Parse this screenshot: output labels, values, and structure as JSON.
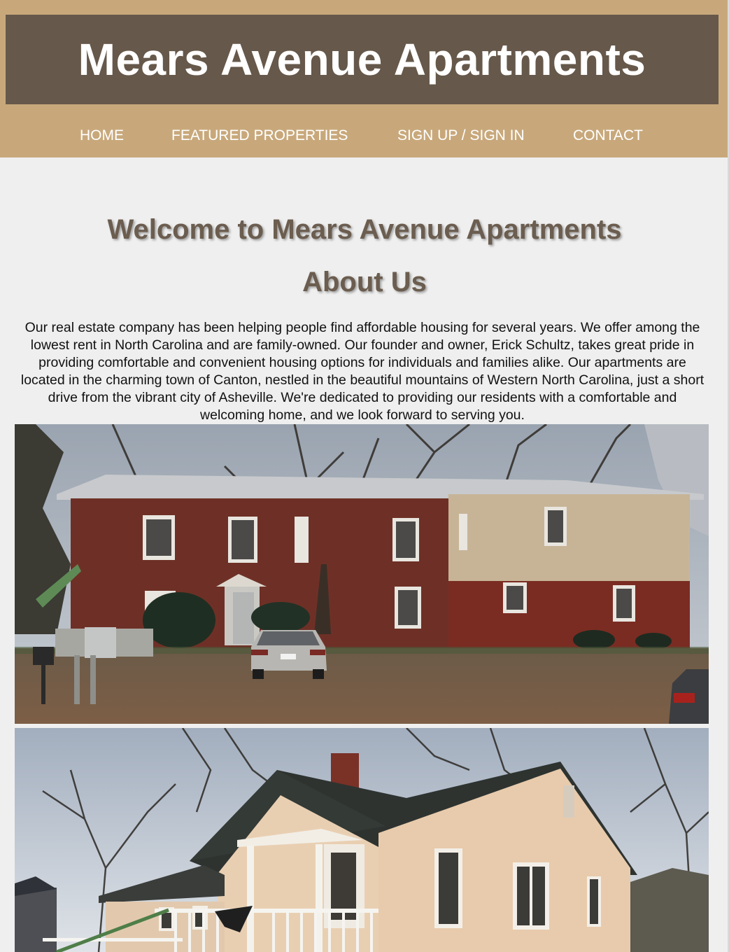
{
  "header": {
    "title": "Mears Avenue Apartments"
  },
  "nav": {
    "items": [
      {
        "label": "HOME"
      },
      {
        "label": "FEATURED PROPERTIES"
      },
      {
        "label": "SIGN UP / SIGN IN"
      },
      {
        "label": "CONTACT"
      }
    ]
  },
  "main": {
    "welcome_heading": "Welcome to Mears Avenue Apartments",
    "about_heading": "About Us",
    "about_text": "Our real estate company has been helping people find affordable housing for several years. We offer among the lowest rent in North Carolina and are family-owned. Our founder and owner, Erick Schultz, takes great pride in providing comfortable and convenient housing options for individuals and families alike. Our apartments are located in the charming town of Canton, nestled in the beautiful mountains of Western North Carolina, just a short drive from the vibrant city of Asheville. We're dedicated to providing our residents with a comfortable and welcoming home, and we look forward to serving you."
  },
  "colors": {
    "page_bg": "#efefef",
    "band": "#c8a87b",
    "header_box": "#66584a",
    "heading_text": "#6b5d4f"
  }
}
